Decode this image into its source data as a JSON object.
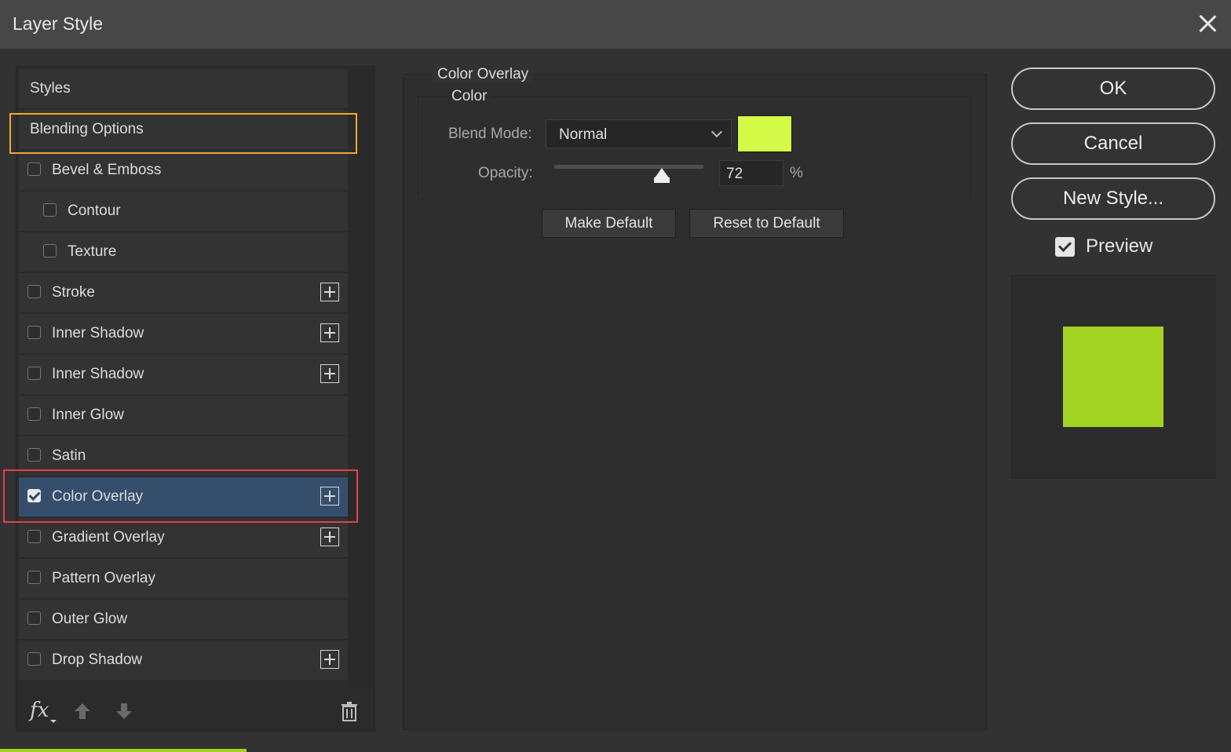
{
  "window": {
    "title": "Layer Style"
  },
  "styles_list": {
    "header": "Styles",
    "blending_options": "Blending Options",
    "items": [
      {
        "label": "Bevel & Emboss",
        "checked": false,
        "indent": false,
        "has_plus": false
      },
      {
        "label": "Contour",
        "checked": false,
        "indent": true,
        "has_plus": false
      },
      {
        "label": "Texture",
        "checked": false,
        "indent": true,
        "has_plus": false
      },
      {
        "label": "Stroke",
        "checked": false,
        "indent": false,
        "has_plus": true
      },
      {
        "label": "Inner Shadow",
        "checked": false,
        "indent": false,
        "has_plus": true
      },
      {
        "label": "Inner Shadow",
        "checked": false,
        "indent": false,
        "has_plus": true
      },
      {
        "label": "Inner Glow",
        "checked": false,
        "indent": false,
        "has_plus": false
      },
      {
        "label": "Satin",
        "checked": false,
        "indent": false,
        "has_plus": false
      },
      {
        "label": "Color Overlay",
        "checked": true,
        "indent": false,
        "has_plus": true,
        "selected": true
      },
      {
        "label": "Gradient Overlay",
        "checked": false,
        "indent": false,
        "has_plus": true
      },
      {
        "label": "Pattern Overlay",
        "checked": false,
        "indent": false,
        "has_plus": false
      },
      {
        "label": "Outer Glow",
        "checked": false,
        "indent": false,
        "has_plus": false
      },
      {
        "label": "Drop Shadow",
        "checked": false,
        "indent": false,
        "has_plus": true
      }
    ],
    "footer": {
      "fx": "fx"
    }
  },
  "color_overlay": {
    "group_title": "Color Overlay",
    "subgroup_title": "Color",
    "blend_mode_label": "Blend Mode:",
    "blend_mode_value": "Normal",
    "swatch_color": "#d4f946",
    "opacity_label": "Opacity:",
    "opacity_value": "72",
    "opacity_unit": "%",
    "opacity_fraction": 0.72,
    "make_default": "Make Default",
    "reset_default": "Reset to Default"
  },
  "actions": {
    "ok": "OK",
    "cancel": "Cancel",
    "new_style": "New Style...",
    "preview_label": "Preview",
    "preview_checked": true,
    "preview_color": "#a2d322"
  },
  "colors": {
    "selection_highlight": "#354e6c",
    "orange_highlight": "#f0a92c",
    "red_highlight": "#e2424b"
  }
}
